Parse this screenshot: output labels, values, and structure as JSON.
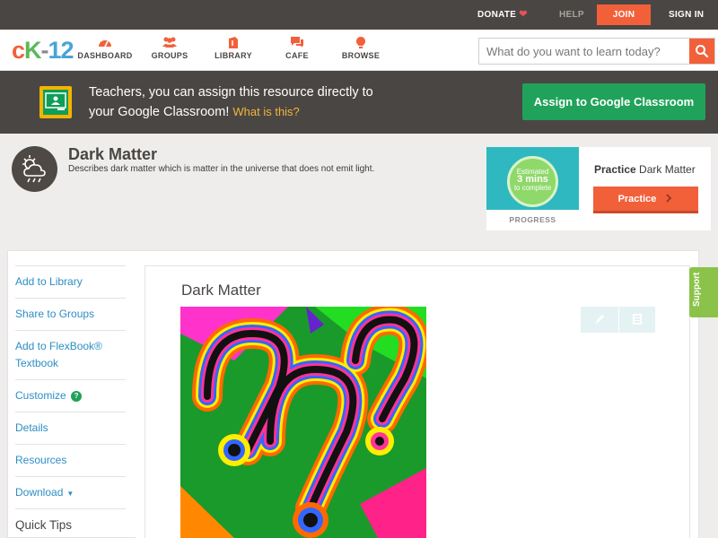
{
  "topbar": {
    "donate": "DONATE",
    "help": "HELP",
    "join": "JOIN",
    "signin": "SIGN IN"
  },
  "header": {
    "logo_c": "c",
    "logo_k": "K",
    "logo_dash": "-",
    "logo_12": "12",
    "nav": [
      {
        "label": "DASHBOARD",
        "icon": "dashboard-icon"
      },
      {
        "label": "GROUPS",
        "icon": "groups-icon"
      },
      {
        "label": "LIBRARY",
        "icon": "library-icon"
      },
      {
        "label": "CAFE",
        "icon": "cafe-icon"
      },
      {
        "label": "BROWSE",
        "icon": "browse-icon"
      }
    ],
    "search_placeholder": "What do you want to learn today?"
  },
  "banner": {
    "line1": "Teachers, you can assign this resource directly to",
    "line2": "your Google Classroom!",
    "what": "What is this?",
    "button": "Assign to Google Classroom"
  },
  "resource": {
    "title": "Dark Matter",
    "description": "Describes dark matter which is matter in the universe that does not emit light."
  },
  "practice": {
    "estimated_line1": "Estimated",
    "estimated_line2": "3 mins",
    "estimated_line3": "to complete",
    "progress_label": "PROGRESS",
    "title_bold": "Practice",
    "title_rest": "Dark Matter",
    "button": "Practice"
  },
  "sidebar": {
    "items": [
      {
        "label": "Add to Library"
      },
      {
        "label": "Share to Groups"
      },
      {
        "label": "Add to FlexBook® Textbook"
      },
      {
        "label": "Customize"
      },
      {
        "label": "Details"
      },
      {
        "label": "Resources"
      },
      {
        "label": "Download"
      },
      {
        "label": "Quick Tips"
      }
    ],
    "help_mark": "?"
  },
  "content": {
    "title": "Dark Matter"
  },
  "support": "Support",
  "colors": {
    "accent": "#f2603a",
    "dark": "#4a4643",
    "green": "#20a25a",
    "link": "#2d8ec4"
  }
}
